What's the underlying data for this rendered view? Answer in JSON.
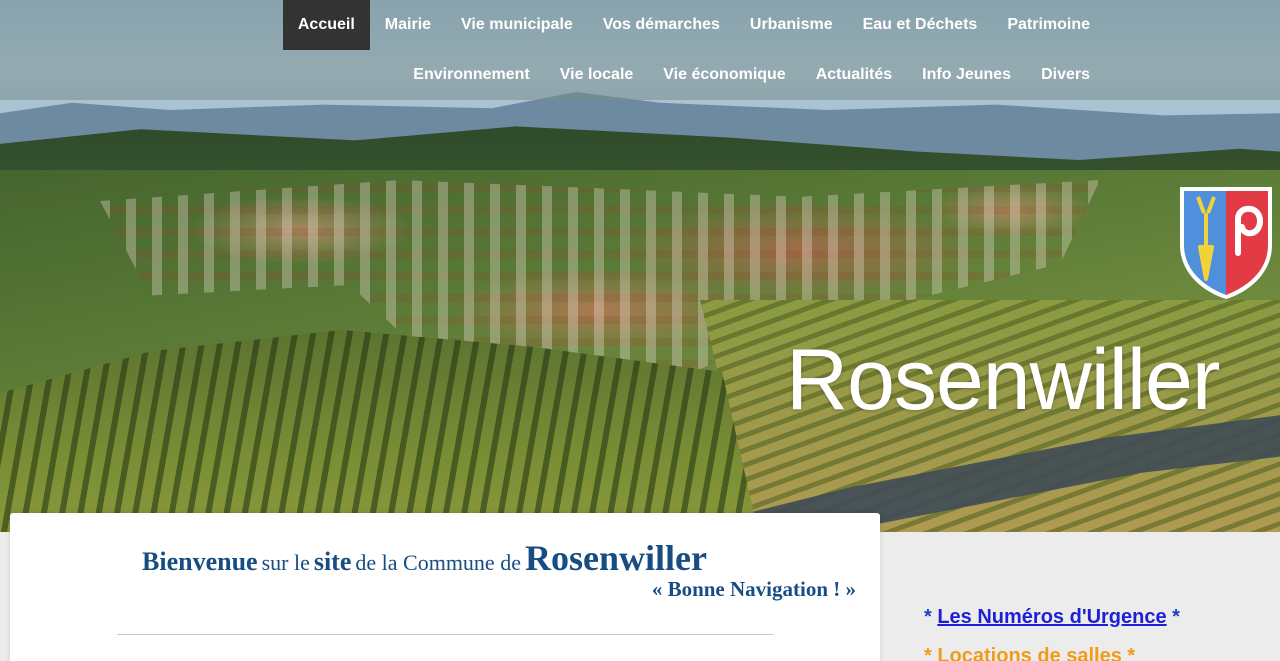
{
  "nav": {
    "row1": [
      "Accueil",
      "Mairie",
      "Vie municipale",
      "Vos démarches",
      "Urbanisme",
      "Eau et Déchets",
      "Patrimoine"
    ],
    "row2": [
      "Environnement",
      "Vie locale",
      "Vie économique",
      "Actualités",
      "Info Jeunes",
      "Divers"
    ],
    "active": "Accueil"
  },
  "hero": {
    "title": "Rosenwiller",
    "crest_icon": "coat-of-arms-icon"
  },
  "welcome": {
    "w1": "Bienvenue",
    "w2": "sur le",
    "w3": "site",
    "w4": "de la Commune de",
    "w5": "Rosenwiller",
    "sub": "« Bonne Navigation ! »"
  },
  "sidebar": {
    "link1_prefix": "* ",
    "link1": "Les Numéros d'Urgence",
    "link1_suffix": " *",
    "link2_prefix": "* ",
    "link2": "Locations de salles",
    "link2_suffix": " *"
  },
  "colors": {
    "nav_active_bg": "#333333",
    "heading_blue": "#174d82",
    "link_blue": "#1f1fd8",
    "link_orange": "#f29a1a"
  }
}
